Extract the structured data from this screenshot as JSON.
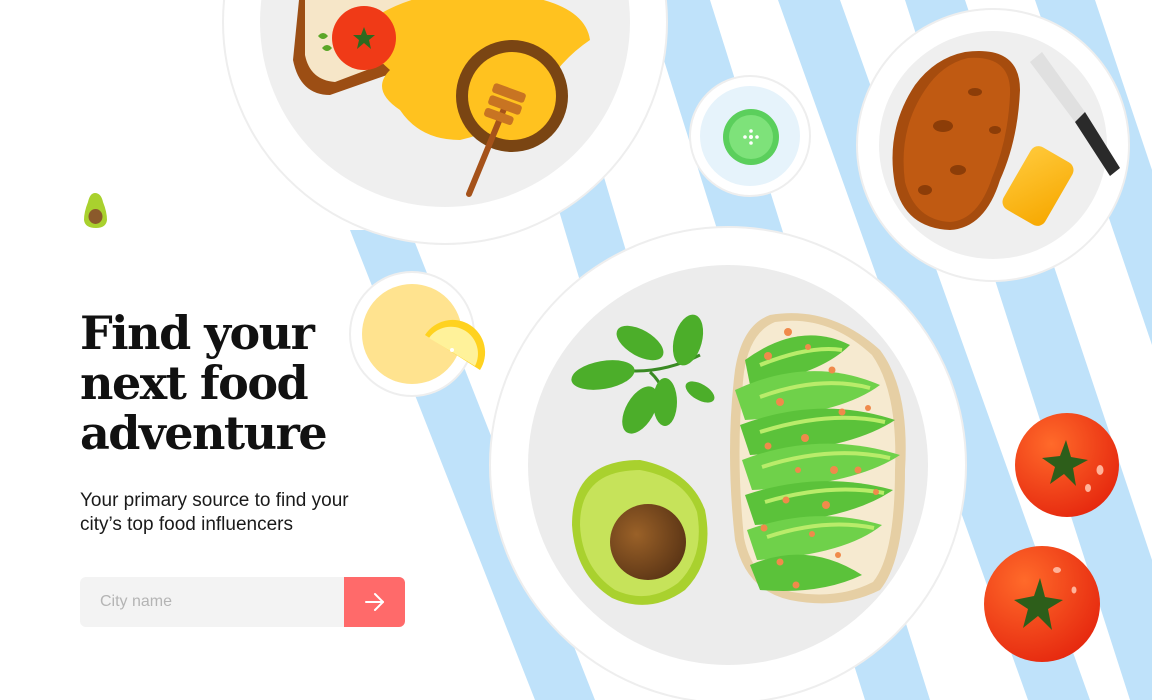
{
  "hero": {
    "title_lines": [
      "Find your",
      "next food",
      "adventure"
    ],
    "subtitle_lines": [
      "Your primary source to find your",
      "city’s top food influencers"
    ]
  },
  "search": {
    "placeholder": "City name",
    "value": "",
    "submit_icon": "arrow-right-icon"
  },
  "brand": {
    "logo_icon": "avocado-logo-icon"
  },
  "colors": {
    "accent": "#ff6a6a",
    "stripe": "#bfe2fa",
    "input_bg": "#f3f3f3",
    "heading": "#111111",
    "avocado_green": "#a9d12e",
    "tomato": "#f4421a"
  }
}
